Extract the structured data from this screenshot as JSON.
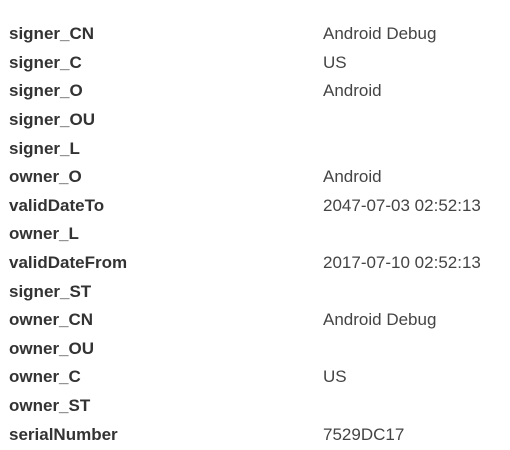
{
  "properties": [
    {
      "key": "signer_CN",
      "value": "Android Debug"
    },
    {
      "key": "signer_C",
      "value": "US"
    },
    {
      "key": "signer_O",
      "value": "Android"
    },
    {
      "key": "signer_OU",
      "value": ""
    },
    {
      "key": "signer_L",
      "value": ""
    },
    {
      "key": "owner_O",
      "value": "Android"
    },
    {
      "key": "validDateTo",
      "value": "2047-07-03 02:52:13"
    },
    {
      "key": "owner_L",
      "value": ""
    },
    {
      "key": "validDateFrom",
      "value": "2017-07-10 02:52:13"
    },
    {
      "key": "signer_ST",
      "value": ""
    },
    {
      "key": "owner_CN",
      "value": "Android Debug"
    },
    {
      "key": "owner_OU",
      "value": ""
    },
    {
      "key": "owner_C",
      "value": "US"
    },
    {
      "key": "owner_ST",
      "value": ""
    },
    {
      "key": "serialNumber",
      "value": "7529DC17"
    }
  ]
}
